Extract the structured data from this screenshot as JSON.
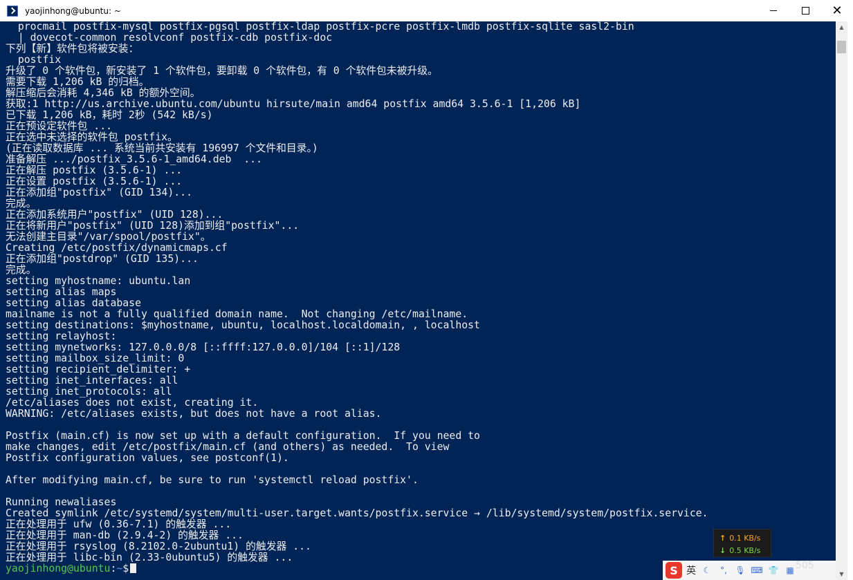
{
  "window": {
    "title": "yaojinhong@ubuntu: ~",
    "controls": {
      "minimize": "",
      "maximize": "",
      "close": "✕"
    }
  },
  "terminal": {
    "lines": [
      "  procmail postfix-mysql postfix-pgsql postfix-ldap postfix-pcre postfix-lmdb postfix-sqlite sasl2-bin",
      "  | dovecot-common resolvconf postfix-cdb postfix-doc",
      "下列【新】软件包将被安装：",
      "  postfix",
      "升级了 0 个软件包，新安装了 1 个软件包，要卸载 0 个软件包，有 0 个软件包未被升级。",
      "需要下载 1,206 kB 的归档。",
      "解压缩后会消耗 4,346 kB 的额外空间。",
      "获取:1 http://us.archive.ubuntu.com/ubuntu hirsute/main amd64 postfix amd64 3.5.6-1 [1,206 kB]",
      "已下载 1,206 kB，耗时 2秒 (542 kB/s)",
      "正在预设定软件包 ...",
      "正在选中未选择的软件包 postfix。",
      "(正在读取数据库 ... 系统当前共安装有 196997 个文件和目录。)",
      "准备解压 .../postfix_3.5.6-1_amd64.deb  ...",
      "正在解压 postfix (3.5.6-1) ...",
      "正在设置 postfix (3.5.6-1) ...",
      "正在添加组\"postfix\" (GID 134)...",
      "完成。",
      "正在添加系统用户\"postfix\" (UID 128)...",
      "正在将新用户\"postfix\" (UID 128)添加到组\"postfix\"...",
      "无法创建主目录\"/var/spool/postfix\"。",
      "Creating /etc/postfix/dynamicmaps.cf",
      "正在添加组\"postdrop\" (GID 135)...",
      "完成。",
      "setting myhostname: ubuntu.lan",
      "setting alias maps",
      "setting alias database",
      "mailname is not a fully qualified domain name.  Not changing /etc/mailname.",
      "setting destinations: $myhostname, ubuntu, localhost.localdomain, , localhost",
      "setting relayhost:",
      "setting mynetworks: 127.0.0.0/8 [::ffff:127.0.0.0]/104 [::1]/128",
      "setting mailbox_size_limit: 0",
      "setting recipient_delimiter: +",
      "setting inet_interfaces: all",
      "setting inet_protocols: all",
      "/etc/aliases does not exist, creating it.",
      "WARNING: /etc/aliases exists, but does not have a root alias.",
      "",
      "Postfix (main.cf) is now set up with a default configuration.  If you need to",
      "make changes, edit /etc/postfix/main.cf (and others) as needed.  To view",
      "Postfix configuration values, see postconf(1).",
      "",
      "After modifying main.cf, be sure to run 'systemctl reload postfix'.",
      "",
      "Running newaliases",
      "Created symlink /etc/systemd/system/multi-user.target.wants/postfix.service → /lib/systemd/system/postfix.service.",
      "正在处理用于 ufw (0.36-7.1) 的触发器 ...",
      "正在处理用于 man-db (2.9.4-2) 的触发器 ...",
      "正在处理用于 rsyslog (8.2102.0-2ubuntu1) 的触发器 ...",
      "正在处理用于 libc-bin (2.33-0ubuntu5) 的触发器 ..."
    ],
    "prompt": {
      "user_host": "yaojinhong@ubuntu",
      "separator": ":",
      "path": "~",
      "symbol": "$"
    },
    "colors": {
      "background": "#012456",
      "text": "#eeedf0",
      "prompt_user": "#4ec94e",
      "prompt_path": "#5b8cf0"
    }
  },
  "net_speed": {
    "upload": "0.1 KB/s",
    "download": "0.5 KB/s",
    "upload_arrow": "↑",
    "download_arrow": "↓"
  },
  "ime": {
    "logo": "S",
    "language": "英",
    "icons": [
      "moon-icon",
      "comma-icon",
      "mic-icon",
      "keyboard-icon",
      "shirt-icon",
      "grid-icon"
    ]
  },
  "watermark": "505"
}
